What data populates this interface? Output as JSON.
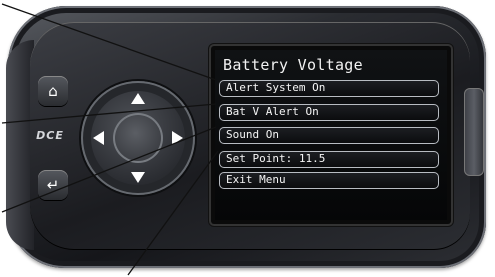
{
  "device": {
    "brand_logo": "DCE",
    "home_icon": "home-icon",
    "back_icon": "back-arrow-icon"
  },
  "screen": {
    "title": "Battery Voltage",
    "menu": [
      {
        "label": "Alert System On"
      },
      {
        "label": "Bat V Alert On"
      },
      {
        "label": "Sound On"
      },
      {
        "label": "Set Point: 11.5"
      },
      {
        "label": "Exit Menu"
      }
    ]
  },
  "colors": {
    "screen_background": "#0b0c0e",
    "menu_border": "#b8bcc2",
    "text": "#f5f5f5"
  }
}
